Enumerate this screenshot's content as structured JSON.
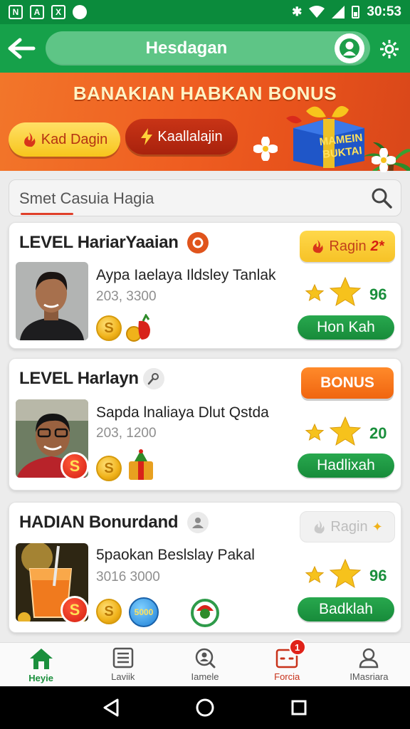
{
  "status_bar": {
    "time": "30:53",
    "left_icons": [
      "N",
      "A",
      "X"
    ]
  },
  "app_bar": {
    "title": "Hesdagan"
  },
  "banner": {
    "title": "BANAKIAN HABKAN BONUS",
    "button1_label": "Kad Dagin",
    "button2_label": "Kaallalajin",
    "gift_text_line1": "MAMEIN",
    "gift_text_line2": "BUKTAI"
  },
  "search": {
    "placeholder": "Smet Casuia Hagia"
  },
  "cards": [
    {
      "title": "LEVEL HariarYaaian",
      "description": "Aypa Iaelaya Ildsley Tanlak",
      "number": "203, 3300",
      "action_label": "Ragin",
      "action_badge": "2*",
      "rating": "96",
      "button_label": "Hon Kah"
    },
    {
      "title": "LEVEL Harlayn",
      "description": "Sapda lnaliaya Dlut Qstda",
      "number": "203, 1200",
      "action_label": "BONUS",
      "rating": "20",
      "button_label": "Hadlixah"
    },
    {
      "title": "HADIAN Bonurdand",
      "description": "5paokan Beslslay Pakal",
      "number": "3016 3000",
      "action_label": "Ragin",
      "rating": "96",
      "button_label": "Badklah",
      "coin_label": "5000"
    }
  ],
  "coin_symbol": "S",
  "bottom_nav": [
    {
      "label": "Heyie",
      "icon": "home-icon",
      "active": true
    },
    {
      "label": "Laviik",
      "icon": "list-icon",
      "active": false
    },
    {
      "label": "Iamele",
      "icon": "search-person-icon",
      "active": false
    },
    {
      "label": "Forcia",
      "icon": "inbox-icon",
      "active": false,
      "badge": "1"
    },
    {
      "label": "IMasriara",
      "icon": "profile-icon",
      "active": false
    }
  ],
  "colors": {
    "primary_green": "#16a14a",
    "accent_orange": "#f06510",
    "active_nav": "#1a8f3c",
    "alert_red": "#c8321a"
  }
}
